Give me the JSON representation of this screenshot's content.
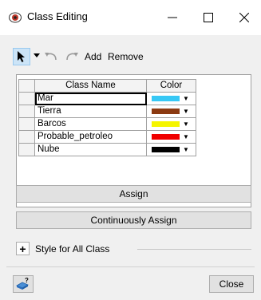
{
  "window": {
    "title": "Class Editing",
    "min_glyph": "—",
    "max_glyph": "☐",
    "close_glyph": "✕",
    "app_icon": "eye-icon"
  },
  "toolbar": {
    "add_label": "Add",
    "remove_label": "Remove",
    "icons": [
      "select-arrow-icon",
      "dropdown-icon",
      "undo-icon",
      "redo-icon"
    ]
  },
  "table": {
    "columns": [
      "Class Name",
      "Color"
    ],
    "rows": [
      {
        "name": "Mar",
        "color": "#37c8f5"
      },
      {
        "name": "Tierra",
        "color": "#8b3a12"
      },
      {
        "name": "Barcos",
        "color": "#f5f500"
      },
      {
        "name": "Probable_petroleo",
        "color": "#f00000"
      },
      {
        "name": "Nube",
        "color": "#000000"
      }
    ]
  },
  "buttons": {
    "assign": "Assign",
    "continuous_assign": "Continuously Assign",
    "close": "Close"
  },
  "style_section": {
    "expand_glyph": "+",
    "label": "Style for All Class"
  }
}
